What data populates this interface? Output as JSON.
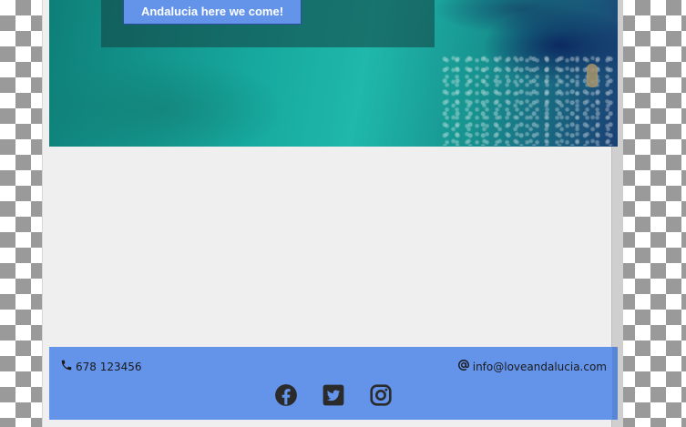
{
  "hero": {
    "cta_label": "Andalucia here we come!"
  },
  "footer": {
    "phone": "678 123456",
    "email": "info@loveandalucia.com",
    "social": [
      "facebook-icon",
      "twitter-icon",
      "instagram-icon"
    ]
  },
  "colors": {
    "footer_bg": "#6493ea",
    "button_bg": "#6494ea",
    "page_bg": "#efefef"
  }
}
